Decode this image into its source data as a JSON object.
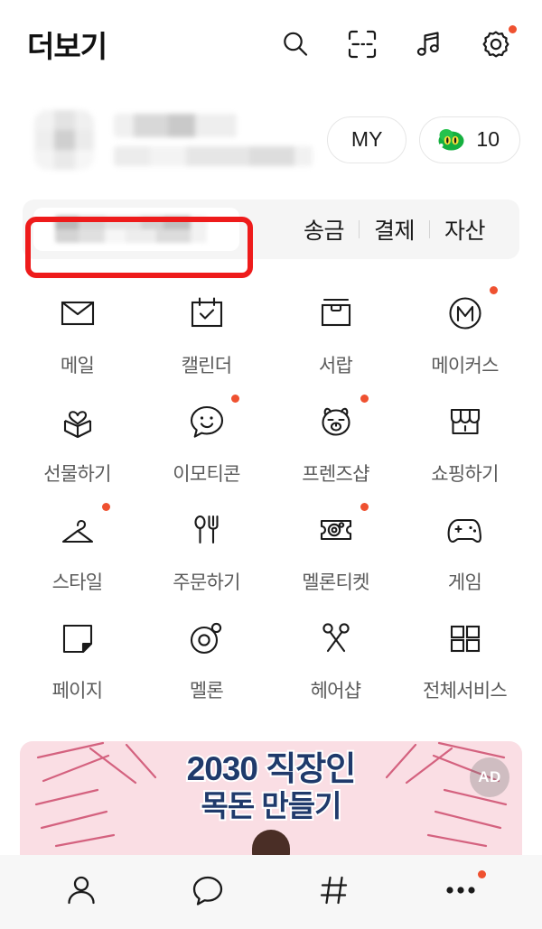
{
  "header": {
    "title": "더보기",
    "icons": [
      {
        "name": "search-icon",
        "label": "검색"
      },
      {
        "name": "qr-scan-icon",
        "label": "코드스캔"
      },
      {
        "name": "music-note-icon",
        "label": "뮤직"
      },
      {
        "name": "gear-icon",
        "label": "설정",
        "badge": true
      }
    ]
  },
  "profile": {
    "avatar_masked": true,
    "name_masked": true,
    "status_masked": true,
    "my_button_label": "MY",
    "emoticon_icon": "emoticon-character-icon",
    "emoticon_count": "10"
  },
  "paybar": {
    "chip_masked": true,
    "links": [
      "송금",
      "결제",
      "자산"
    ],
    "highlight": {
      "color": "#ee1b1b",
      "target": "pay-balance-chip"
    }
  },
  "grid": {
    "items": [
      {
        "label": "메일",
        "icon": "envelope-icon",
        "badge": false
      },
      {
        "label": "캘린더",
        "icon": "calendar-check-icon",
        "badge": false
      },
      {
        "label": "서랍",
        "icon": "drawer-icon",
        "badge": false
      },
      {
        "label": "메이커스",
        "icon": "makers-m-circle-icon",
        "badge": true
      },
      {
        "label": "선물하기",
        "icon": "gift-box-heart-icon",
        "badge": false
      },
      {
        "label": "이모티콘",
        "icon": "smiley-speech-bubble-icon",
        "badge": true
      },
      {
        "label": "프렌즈샵",
        "icon": "ryan-face-icon",
        "badge": true
      },
      {
        "label": "쇼핑하기",
        "icon": "storefront-icon",
        "badge": false
      },
      {
        "label": "스타일",
        "icon": "hanger-icon",
        "badge": true
      },
      {
        "label": "주문하기",
        "icon": "spoon-fork-icon",
        "badge": false
      },
      {
        "label": "멜론티켓",
        "icon": "ticket-icon",
        "badge": true
      },
      {
        "label": "게임",
        "icon": "gamepad-icon",
        "badge": false
      },
      {
        "label": "페이지",
        "icon": "page-note-icon",
        "badge": false
      },
      {
        "label": "멜론",
        "icon": "melon-circle-icon",
        "badge": false
      },
      {
        "label": "헤어샵",
        "icon": "scissors-icon",
        "badge": false
      },
      {
        "label": "전체서비스",
        "icon": "grid-four-squares-icon",
        "badge": false
      }
    ]
  },
  "ad": {
    "line1": "2030 직장인",
    "line2": "목돈 만들기",
    "badge": "AD",
    "bg_color": "#fadee4",
    "text_color": "#1f3a6b"
  },
  "bottom_nav": {
    "items": [
      {
        "name": "nav-friends",
        "icon": "person-icon",
        "badge": false,
        "active": false
      },
      {
        "name": "nav-chats",
        "icon": "speech-bubble-icon",
        "badge": false,
        "active": false
      },
      {
        "name": "nav-openchat",
        "icon": "hashtag-icon",
        "badge": false,
        "active": false
      },
      {
        "name": "nav-more",
        "icon": "three-dots-icon",
        "badge": true,
        "active": true
      }
    ]
  },
  "colors": {
    "badge_red": "#ef5130",
    "highlight_red": "#ee1b1b",
    "paybar_bg": "#f5f5f5",
    "nav_bg": "#f7f7f7",
    "label_gray": "#5a5a5a"
  }
}
